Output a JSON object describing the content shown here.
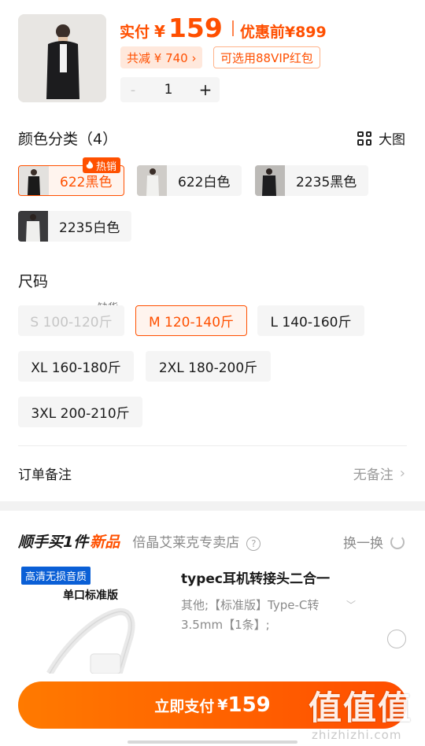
{
  "summary": {
    "price_label": "实付",
    "currency": "¥",
    "price": "159",
    "original_label": "优惠前",
    "original_price": "¥899",
    "discount_text": "共减 ¥ 740 ›",
    "vip_text": "可选用88VIP红包",
    "quantity": "1",
    "minus": "-",
    "plus": "+"
  },
  "color": {
    "title": "颜色分类（4）",
    "big_view": "大图",
    "hot_label": "热销",
    "options": [
      {
        "label": "622黑色",
        "selected": true
      },
      {
        "label": "622白色",
        "selected": false
      },
      {
        "label": "2235黑色",
        "selected": false
      },
      {
        "label": "2235白色",
        "selected": false
      }
    ]
  },
  "size": {
    "title": "尺码",
    "out_of_stock": "缺货",
    "options": [
      {
        "label": "S 100-120斤",
        "state": "disabled"
      },
      {
        "label": "M 120-140斤",
        "state": "selected"
      },
      {
        "label": "L 140-160斤",
        "state": "normal"
      },
      {
        "label": "XL 160-180斤",
        "state": "normal"
      },
      {
        "label": "2XL 180-200斤",
        "state": "normal"
      },
      {
        "label": "3XL 200-210斤",
        "state": "normal"
      }
    ]
  },
  "note": {
    "label": "订单备注",
    "value": "无备注",
    "chevron": "›"
  },
  "upsell": {
    "title": "顺手买1件",
    "new_label": "新品",
    "store": "倍晶艾莱克专卖店",
    "help": "?",
    "swap": "换一换",
    "tag_quality": "高清无损音质",
    "tag_version": "单口标准版",
    "product_title": "typec耳机转接头二合一",
    "product_spec": "其他;【标准版】Type-C转 3.5mm【1条】;",
    "spec_chevron": "﹀"
  },
  "pay": {
    "label": "立即支付",
    "currency": "¥",
    "amount": "159"
  },
  "watermark": {
    "logo": "值值值",
    "url": "zhizhizhi.com"
  },
  "colors": {
    "accent": "#ff5000",
    "accent_light": "#fff4ee",
    "chip_bg": "#f5f5f5"
  }
}
